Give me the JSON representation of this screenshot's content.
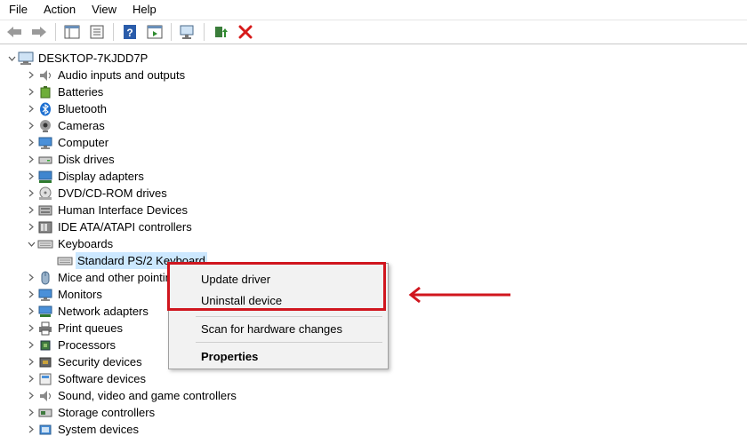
{
  "menubar": {
    "items": [
      "File",
      "Action",
      "View",
      "Help"
    ]
  },
  "toolbar": {
    "buttons": [
      "back-icon",
      "forward-icon",
      "show-hide-tree-icon",
      "properties-icon",
      "help-icon",
      "action-pane-icon",
      "scan-hardware-icon",
      "update-driver-icon",
      "uninstall-icon"
    ]
  },
  "tree": {
    "root": "DESKTOP-7KJDD7P",
    "items": [
      "Audio inputs and outputs",
      "Batteries",
      "Bluetooth",
      "Cameras",
      "Computer",
      "Disk drives",
      "Display adapters",
      "DVD/CD-ROM drives",
      "Human Interface Devices",
      "IDE ATA/ATAPI controllers",
      "Keyboards",
      "Standard PS/2 Keyboard",
      "Mice and other pointing devices",
      "Monitors",
      "Network adapters",
      "Print queues",
      "Processors",
      "Security devices",
      "Software devices",
      "Sound, video and game controllers",
      "Storage controllers",
      "System devices"
    ]
  },
  "context_menu": {
    "update_driver": "Update driver",
    "uninstall_device": "Uninstall device",
    "scan": "Scan for hardware changes",
    "properties": "Properties"
  },
  "colors": {
    "highlight": "#d0161e",
    "selection": "#cce8ff"
  }
}
